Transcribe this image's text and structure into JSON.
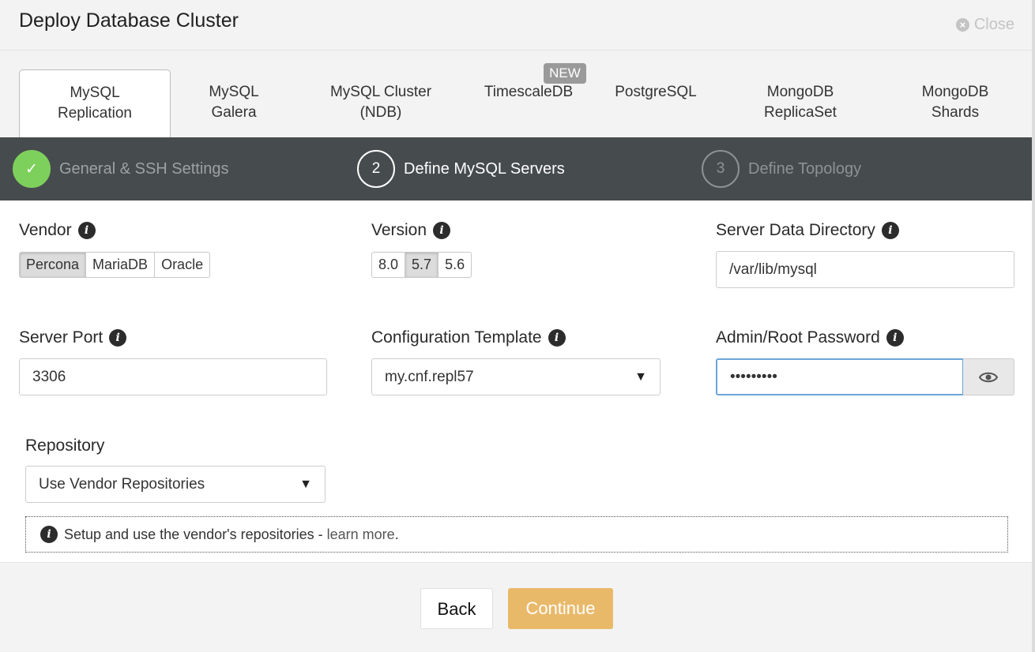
{
  "header": {
    "title": "Deploy Database Cluster",
    "close_label": "Close"
  },
  "tabs": [
    {
      "line1": "MySQL",
      "line2": "Replication"
    },
    {
      "line1": "MySQL",
      "line2": "Galera"
    },
    {
      "line1": "MySQL Cluster",
      "line2": "(NDB)"
    },
    {
      "line1": "TimescaleDB",
      "line2": ""
    },
    {
      "line1": "PostgreSQL",
      "line2": ""
    },
    {
      "line1": "MongoDB",
      "line2": "ReplicaSet"
    },
    {
      "line1": "MongoDB",
      "line2": "Shards"
    }
  ],
  "new_badge": "NEW",
  "wizard": {
    "steps": [
      {
        "label": "General & SSH Settings",
        "marker": "✓"
      },
      {
        "label": "Define MySQL Servers",
        "marker": "2"
      },
      {
        "label": "Define Topology",
        "marker": "3"
      }
    ]
  },
  "form": {
    "vendor": {
      "label": "Vendor",
      "options": [
        "Percona",
        "MariaDB",
        "Oracle"
      ],
      "selected": "Percona"
    },
    "version": {
      "label": "Version",
      "options": [
        "8.0",
        "5.7",
        "5.6"
      ],
      "selected": "5.7"
    },
    "data_dir": {
      "label": "Server Data Directory",
      "value": "/var/lib/mysql"
    },
    "port": {
      "label": "Server Port",
      "value": "3306"
    },
    "config_template": {
      "label": "Configuration Template",
      "value": "my.cnf.repl57"
    },
    "password": {
      "label": "Admin/Root Password",
      "value": "•••••••••"
    },
    "repository": {
      "label": "Repository",
      "value": "Use Vendor Repositories"
    },
    "note": {
      "text": "Setup and use the vendor's repositories - ",
      "link": "learn more",
      "end": "."
    }
  },
  "footer": {
    "back_label": "Back",
    "continue_label": "Continue"
  },
  "colors": {
    "accent_continue": "#e9b96a",
    "wizard_bg": "#464b4d",
    "done_green": "#7ed05c",
    "focus_border": "#6ea5d8"
  }
}
